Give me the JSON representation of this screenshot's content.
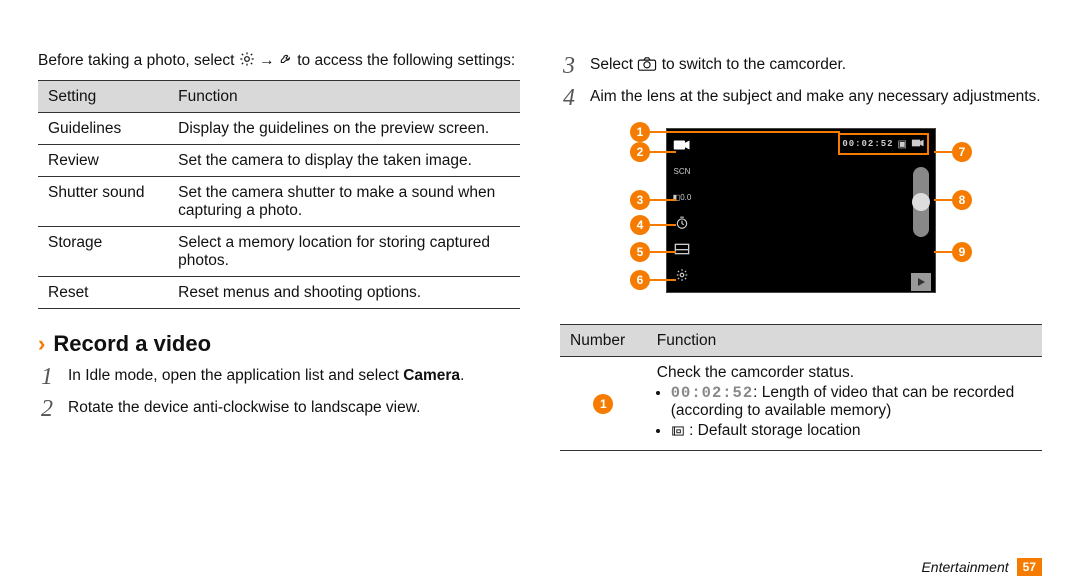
{
  "left": {
    "intro_before": "Before taking a photo, select ",
    "intro_after_arrow": " → ",
    "intro_after": " to access the following settings:",
    "table": {
      "header": {
        "setting": "Setting",
        "function": "Function"
      },
      "rows": [
        {
          "setting": "Guidelines",
          "function": "Display the guidelines on the preview screen."
        },
        {
          "setting": "Review",
          "function": "Set the camera to display the taken image."
        },
        {
          "setting": "Shutter sound",
          "function": "Set the camera shutter to make a sound when capturing a photo."
        },
        {
          "setting": "Storage",
          "function": "Select a memory location for storing captured photos."
        },
        {
          "setting": "Reset",
          "function": "Reset menus and shooting options."
        }
      ]
    },
    "section": {
      "title": "Record a video",
      "steps": [
        {
          "n": "1",
          "text_before": "In Idle mode, open the application list and select ",
          "bold": "Camera",
          "text_after": "."
        },
        {
          "n": "2",
          "text_before": "Rotate the device anti-clockwise to landscape view.",
          "bold": "",
          "text_after": ""
        }
      ]
    }
  },
  "right": {
    "steps": [
      {
        "n": "3",
        "text_before": "Select ",
        "icon": "camera-icon",
        "text_after": " to switch to the camcorder."
      },
      {
        "n": "4",
        "text_before": "Aim the lens at the subject and make any necessary adjustments.",
        "icon": "",
        "text_after": ""
      }
    ],
    "camcorder": {
      "timer": "00:02:52",
      "callouts": [
        "1",
        "2",
        "3",
        "4",
        "5",
        "6",
        "7",
        "8",
        "9"
      ],
      "left_items": [
        {
          "name": "camcorder-mode-icon"
        },
        {
          "name": "scene-mode-icon",
          "label": "SCN"
        },
        {
          "name": "exposure-icon",
          "label": "0.0"
        },
        {
          "name": "timer-icon"
        },
        {
          "name": "resolution-icon"
        },
        {
          "name": "settings-gear-icon"
        }
      ]
    },
    "table": {
      "header": {
        "number": "Number",
        "function": "Function"
      },
      "row1": {
        "num": "1",
        "func_title": "Check the camcorder status.",
        "bullets": [
          {
            "code": "00:02:52",
            "text": ": Length of video that can be recorded (according to available memory)"
          },
          {
            "code": "",
            "text": ": Default storage location",
            "icon": "storage-icon"
          }
        ]
      }
    }
  },
  "footer": {
    "section": "Entertainment",
    "page": "57"
  }
}
